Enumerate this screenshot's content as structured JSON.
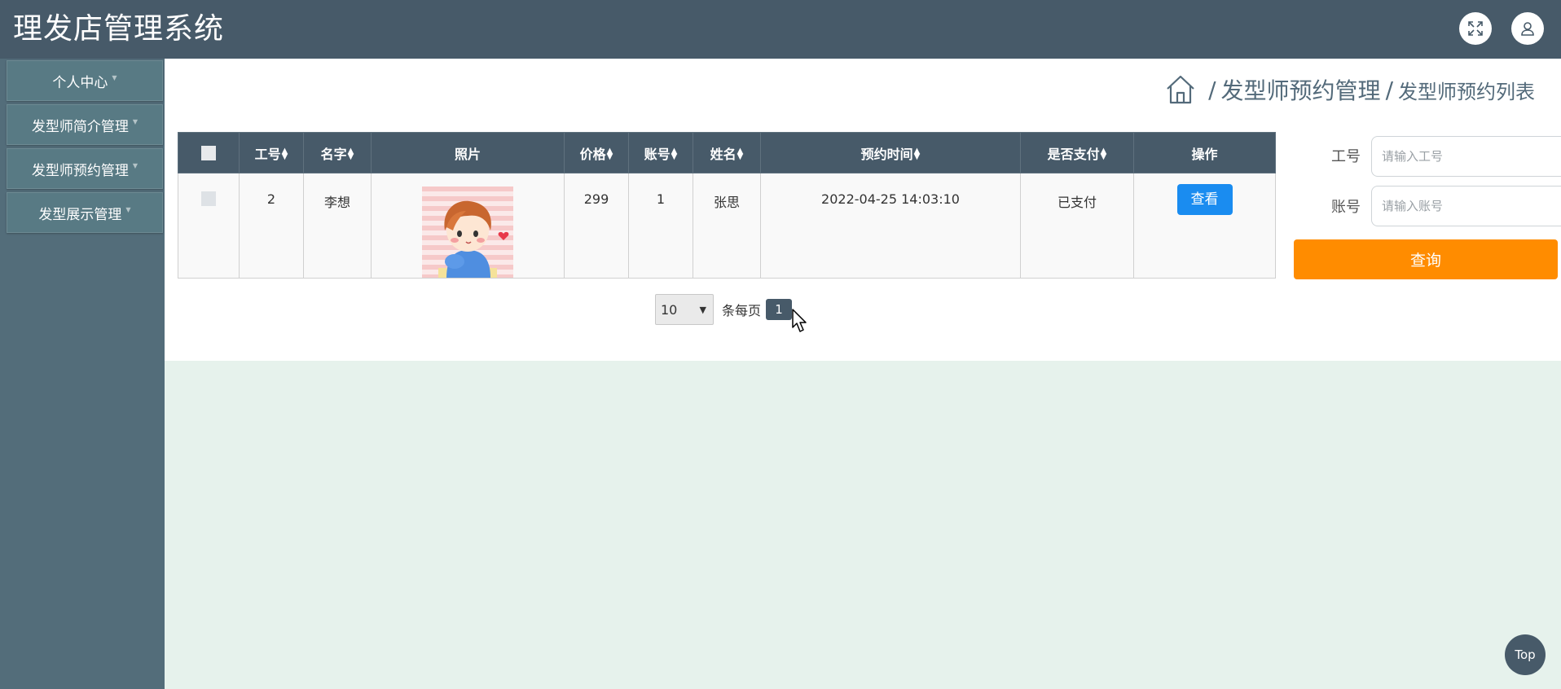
{
  "header": {
    "title": "理发店管理系统"
  },
  "sidebar": {
    "items": [
      {
        "label": "个人中心"
      },
      {
        "label": "发型师简介管理"
      },
      {
        "label": "发型师预约管理"
      },
      {
        "label": "发型展示管理"
      }
    ]
  },
  "breadcrumb": {
    "level1": "发型师预约管理",
    "level2": "发型师预约列表",
    "separator": "/"
  },
  "table": {
    "columns": [
      "工号",
      "名字",
      "照片",
      "价格",
      "账号",
      "姓名",
      "预约时间",
      "是否支付",
      "操作"
    ],
    "rows": [
      {
        "id": "2",
        "name": "李想",
        "price": "299",
        "account": "1",
        "customer": "张思",
        "time": "2022-04-25 14:03:10",
        "paid": "已支付",
        "action": "查看"
      }
    ]
  },
  "pagination": {
    "page_size": "10",
    "per_page_label": "条每页",
    "current_page": "1"
  },
  "search": {
    "id_label": "工号",
    "id_placeholder": "请输入工号",
    "account_label": "账号",
    "account_placeholder": "请输入账号",
    "query_label": "查询"
  },
  "back_to_top": "Top",
  "colors": {
    "header": "#475a69",
    "sidebar": "#536d7a",
    "accent": "#ff8c00",
    "primary": "#1a8cf0"
  }
}
